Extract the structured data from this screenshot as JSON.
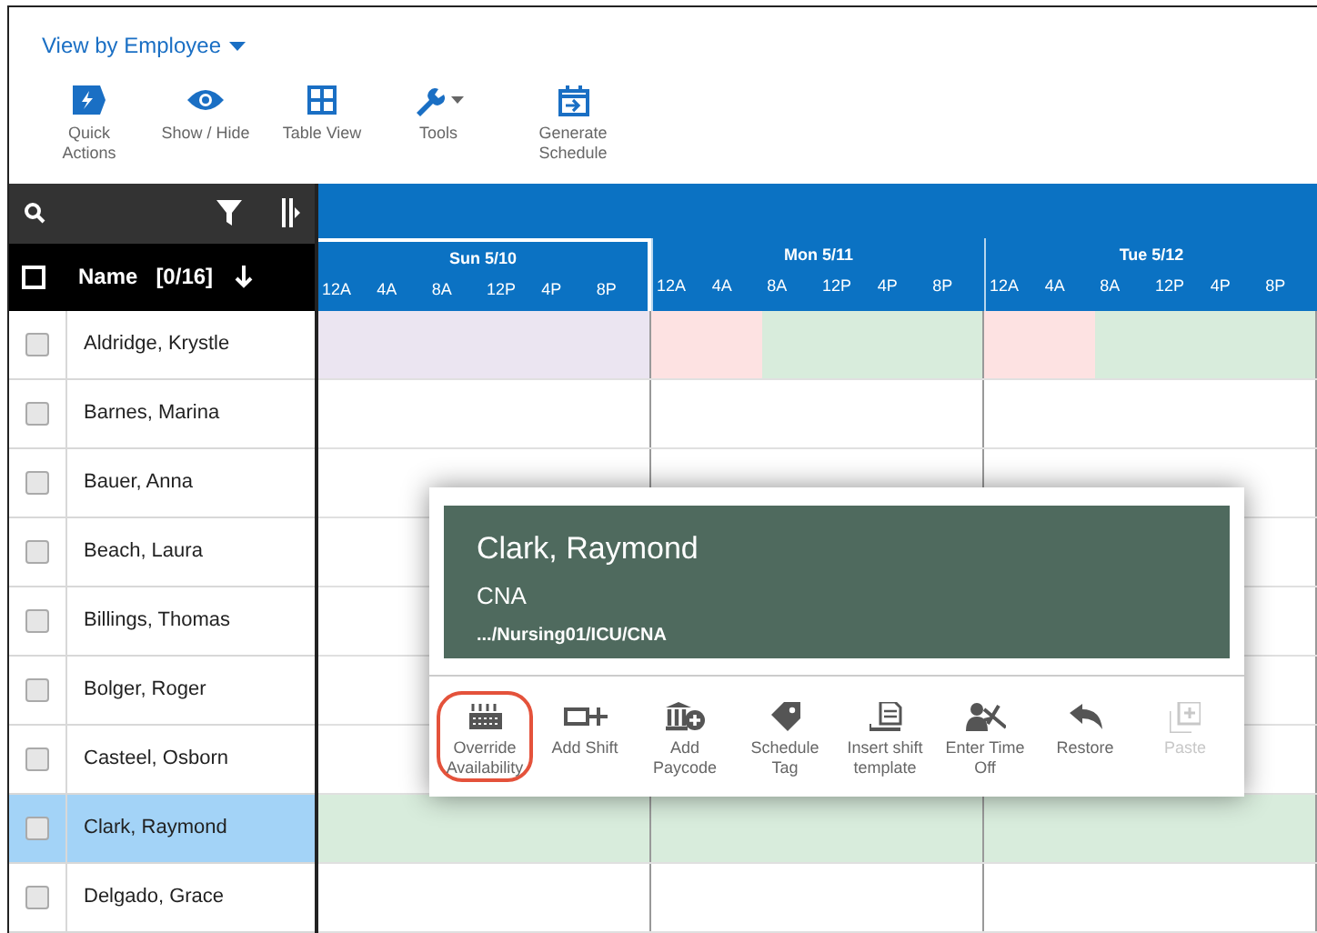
{
  "view_selector": {
    "label": "View by Employee"
  },
  "toolbar": [
    {
      "kind": "bolt",
      "label": "Quick Actions",
      "caret": false
    },
    {
      "kind": "eye",
      "label": "Show / Hide",
      "caret": false
    },
    {
      "kind": "grid",
      "label": "Table View",
      "caret": false
    },
    {
      "kind": "wrench",
      "label": "Tools",
      "caret": true
    },
    {
      "kind": "calendar",
      "label": "Generate Schedule",
      "caret": false
    }
  ],
  "name_header": {
    "label": "Name",
    "count": "[0/16]",
    "checked": false
  },
  "days": [
    {
      "label": "Sun 5/10",
      "selected": true,
      "ticks": [
        "12A",
        "4A",
        "8A",
        "12P",
        "4P",
        "8P"
      ]
    },
    {
      "label": "Mon 5/11",
      "selected": false,
      "ticks": [
        "12A",
        "4A",
        "8A",
        "12P",
        "4P",
        "8P"
      ]
    },
    {
      "label": "Tue 5/12",
      "selected": false,
      "ticks": [
        "12A",
        "4A",
        "8A",
        "12P",
        "4P",
        "8P"
      ]
    }
  ],
  "rows": [
    {
      "name": "Aldridge, Krystle",
      "checked": false,
      "selected": false,
      "availability": [
        {
          "color": "#ebe5f1"
        },
        {
          "color": "#ebe5f1"
        },
        {
          "color": "#ebe5f1"
        },
        {
          "color": "#ebe5f1"
        },
        {
          "color": "#ebe5f1"
        },
        {
          "color": "#ebe5f1"
        },
        {
          "color": "#fde2e2"
        },
        {
          "color": "#fde2e2"
        },
        {
          "color": "#d8ecdc"
        },
        {
          "color": "#d8ecdc"
        },
        {
          "color": "#d8ecdc"
        },
        {
          "color": "#d8ecdc"
        },
        {
          "color": "#fde2e2"
        },
        {
          "color": "#fde2e2"
        },
        {
          "color": "#d8ecdc"
        },
        {
          "color": "#d8ecdc"
        },
        {
          "color": "#d8ecdc"
        },
        {
          "color": "#d8ecdc"
        }
      ]
    },
    {
      "name": "Barnes, Marina",
      "checked": false,
      "selected": false
    },
    {
      "name": "Bauer, Anna",
      "checked": false,
      "selected": false
    },
    {
      "name": "Beach, Laura",
      "checked": false,
      "selected": false
    },
    {
      "name": "Billings, Thomas",
      "checked": false,
      "selected": false
    },
    {
      "name": "Bolger, Roger",
      "checked": false,
      "selected": false
    },
    {
      "name": "Casteel, Osborn",
      "checked": false,
      "selected": false
    },
    {
      "name": "Clark, Raymond",
      "checked": false,
      "selected": true,
      "availability": [
        {
          "color": "#d8ecdc"
        },
        {
          "color": "#d8ecdc"
        },
        {
          "color": "#d8ecdc"
        },
        {
          "color": "#d8ecdc"
        },
        {
          "color": "#d8ecdc"
        },
        {
          "color": "#d8ecdc"
        },
        {
          "color": "#d8ecdc"
        },
        {
          "color": "#d8ecdc"
        },
        {
          "color": "#d8ecdc"
        },
        {
          "color": "#d8ecdc"
        },
        {
          "color": "#d8ecdc"
        },
        {
          "color": "#d8ecdc"
        },
        {
          "color": "#d8ecdc"
        },
        {
          "color": "#d8ecdc"
        },
        {
          "color": "#d8ecdc"
        },
        {
          "color": "#d8ecdc"
        },
        {
          "color": "#d8ecdc"
        },
        {
          "color": "#d8ecdc"
        }
      ]
    },
    {
      "name": "Delgado, Grace",
      "checked": false,
      "selected": false
    }
  ],
  "popup": {
    "name": "Clark, Raymond",
    "role": "CNA",
    "path": ".../Nursing01/ICU/CNA",
    "actions": [
      {
        "kind": "override",
        "label": "Override Availability",
        "highlighted": true,
        "disabled": false
      },
      {
        "kind": "add_shift",
        "label": "Add Shift",
        "highlighted": false,
        "disabled": false
      },
      {
        "kind": "paycode",
        "label": "Add Paycode",
        "highlighted": false,
        "disabled": false
      },
      {
        "kind": "tag",
        "label": "Schedule Tag",
        "highlighted": false,
        "disabled": false
      },
      {
        "kind": "template",
        "label": "Insert shift template",
        "highlighted": false,
        "disabled": false
      },
      {
        "kind": "timeoff",
        "label": "Enter Time Off",
        "highlighted": false,
        "disabled": false
      },
      {
        "kind": "restore",
        "label": "Restore",
        "highlighted": false,
        "disabled": false
      },
      {
        "kind": "paste",
        "label": "Paste",
        "highlighted": false,
        "disabled": true
      }
    ]
  }
}
